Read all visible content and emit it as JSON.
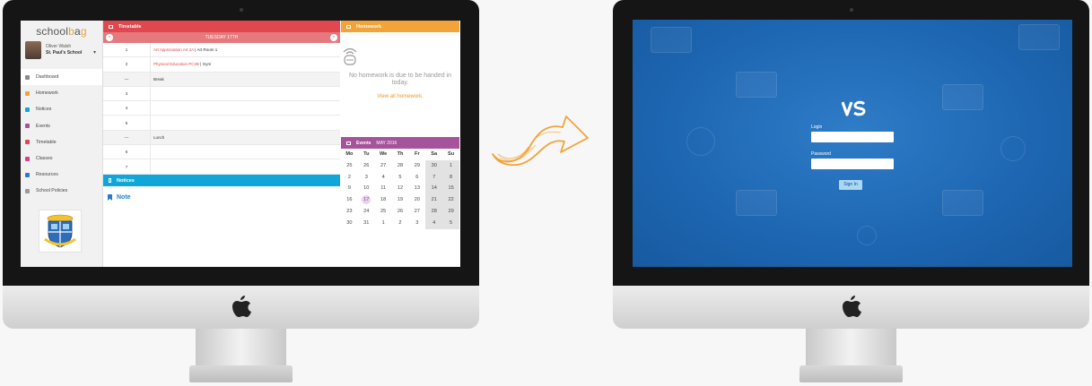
{
  "left_app": {
    "logo": {
      "prefix": "school",
      "b": "b",
      "a_glyph": "a",
      "suffix": "g"
    },
    "profile": {
      "name": "Oliver Walsh",
      "school": "St. Paul's School"
    },
    "nav": [
      {
        "label": "Dashboard",
        "icon": "home-icon",
        "color": "#8a8a8a"
      },
      {
        "label": "Homework",
        "icon": "homework-icon",
        "color": "#f2a33a"
      },
      {
        "label": "Notices",
        "icon": "notices-icon",
        "color": "#10a6d8"
      },
      {
        "label": "Events",
        "icon": "events-icon",
        "color": "#a5539b"
      },
      {
        "label": "Timetable",
        "icon": "timetable-icon",
        "color": "#e0474f"
      },
      {
        "label": "Classes",
        "icon": "classes-icon",
        "color": "#d8408a"
      },
      {
        "label": "Resources",
        "icon": "resources-icon",
        "color": "#2a7ac8"
      },
      {
        "label": "School Policies",
        "icon": "lock-icon",
        "color": "#9a9a9a"
      }
    ],
    "timetable": {
      "title": "Timetable",
      "day": "TUESDAY 17TH",
      "rows": [
        {
          "n": "1",
          "subject": "Art Appreciation Art 2A",
          "room": "Art Room 1"
        },
        {
          "n": "2",
          "subject": "Physical Education PC2B",
          "room": "Gym"
        },
        {
          "n": "—",
          "subject": "",
          "room": "Break"
        },
        {
          "n": "3",
          "subject": "",
          "room": ""
        },
        {
          "n": "4",
          "subject": "",
          "room": ""
        },
        {
          "n": "5",
          "subject": "",
          "room": ""
        },
        {
          "n": "—",
          "subject": "",
          "room": "Lunch"
        },
        {
          "n": "6",
          "subject": "",
          "room": ""
        },
        {
          "n": "7",
          "subject": "",
          "room": ""
        }
      ]
    },
    "notices": {
      "title": "Notices",
      "note": "Note"
    },
    "homework": {
      "title": "Homework",
      "message": "No homework is due to be handed in today.",
      "link": "View all homework."
    },
    "events": {
      "title": "Events",
      "month": "MAY 2016",
      "days": [
        "Mo",
        "Tu",
        "We",
        "Th",
        "Fr",
        "Sa",
        "Su"
      ],
      "weeks": [
        [
          "25",
          "26",
          "27",
          "28",
          "29",
          "30",
          "1"
        ],
        [
          "2",
          "3",
          "4",
          "5",
          "6",
          "7",
          "8"
        ],
        [
          "9",
          "10",
          "11",
          "12",
          "13",
          "14",
          "15"
        ],
        [
          "16",
          "17",
          "18",
          "19",
          "20",
          "21",
          "22"
        ],
        [
          "23",
          "24",
          "25",
          "26",
          "27",
          "28",
          "29"
        ],
        [
          "30",
          "31",
          "1",
          "2",
          "3",
          "4",
          "5"
        ]
      ]
    }
  },
  "login_app": {
    "logo": "VS",
    "login_label": "Login",
    "password_label": "Password",
    "signin": "Sign In",
    "login_value": "",
    "password_value": ""
  }
}
